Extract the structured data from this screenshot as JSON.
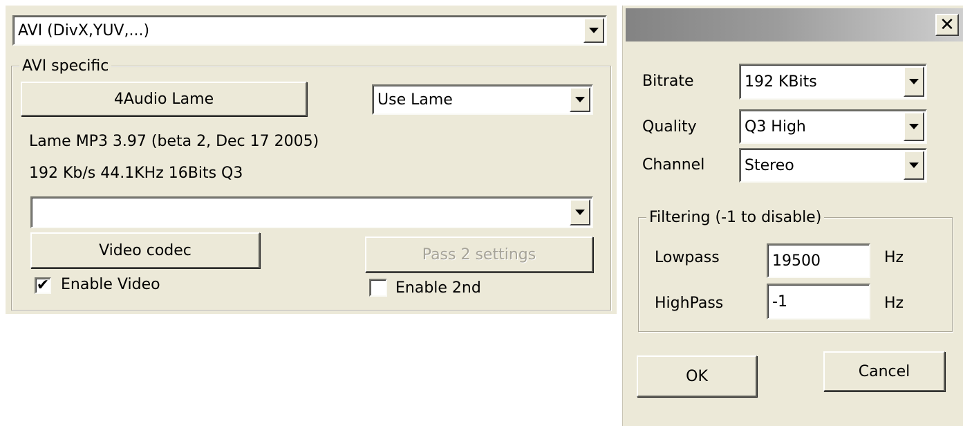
{
  "left": {
    "format_select": {
      "value": "AVI (DivX,YUV,...)"
    },
    "group_title": "AVI specific",
    "audio_button": "4Audio Lame",
    "audio_mode_select": {
      "value": "Use Lame"
    },
    "info_line1": "Lame MP3 3.97 (beta 2, Dec 17 2005)",
    "info_line2": "192 Kb/s 44.1KHz 16Bits Q3",
    "video_codec_select": {
      "value": ""
    },
    "video_codec_button": "Video codec",
    "pass2_button": "Pass 2 settings",
    "enable_video": {
      "label": "Enable Video",
      "checked": true,
      "mark": "✔"
    },
    "enable_2nd": {
      "label": "Enable 2nd",
      "checked": false
    }
  },
  "dialog": {
    "title": "",
    "close_glyph": "✕",
    "bitrate": {
      "label": "Bitrate",
      "value": "192 KBits"
    },
    "quality": {
      "label": "Quality",
      "value": "Q3 High"
    },
    "channel": {
      "label": "Channel",
      "value": "Stereo"
    },
    "filtering": {
      "title": "Filtering (-1 to disable)",
      "lowpass": {
        "label": "Lowpass",
        "value": "19500",
        "unit": "Hz"
      },
      "highpass": {
        "label": "HighPass",
        "value": "-1",
        "unit": "Hz"
      }
    },
    "ok_label": "OK",
    "cancel_label": "Cancel"
  }
}
